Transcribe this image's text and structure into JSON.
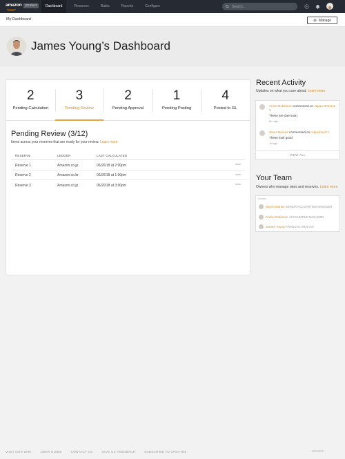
{
  "nav": {
    "logo_brand": "amazon",
    "logo_product": "product",
    "links": [
      "Dashboard",
      "Reserves",
      "Rates",
      "Reports",
      "Configure"
    ],
    "search_placeholder": "Search..."
  },
  "subheader": {
    "title": "My Dashboard",
    "manage_label": "Manage"
  },
  "hero": {
    "title": "James Young’s Dashboard"
  },
  "stats": [
    {
      "value": "2",
      "label": "Pending Calculation"
    },
    {
      "value": "3",
      "label": "Pending Review"
    },
    {
      "value": "2",
      "label": "Pending Approval"
    },
    {
      "value": "1",
      "label": "Pending Posting"
    },
    {
      "value": "4",
      "label": "Posted to GL"
    }
  ],
  "pending_review": {
    "title": "Pending Review (3/12)",
    "desc": "Items across your reserves that are ready for your review.",
    "learn_more": "Learn more",
    "columns": [
      "RESERVE",
      "LEDGER",
      "LAST CALCULATED"
    ],
    "rows": [
      {
        "reserve": "Reserve 1",
        "ledger": "Amazon.co.jp",
        "last": "06/26/18 at 2:00pm"
      },
      {
        "reserve": "Reserve 2",
        "ledger": "Amazon.co.br",
        "last": "06/26/18 at 1:00pm"
      },
      {
        "reserve": "Reserve 3",
        "ledger": "Amazon.co.jp",
        "last": "06/20/18 at 3:00pm"
      }
    ]
  },
  "recent_activity": {
    "title": "Recent Activity",
    "desc": "Updates on what you care about.",
    "learn_more": "Learn more",
    "items": [
      {
        "name": "Annie Robinson",
        "action": "commented on",
        "target": "Japan Reserve 1",
        "body": "These are due soon.",
        "time": "6m ago"
      },
      {
        "name": "Steve Barnes",
        "action": "commented on",
        "target": "Adjustment 1",
        "body": "These look good",
        "time": "1d ago"
      }
    ],
    "view_all": "VIEW ALL"
  },
  "your_team": {
    "title": "Your Team",
    "desc": "Owners who manage rates and reserves.",
    "learn_more": "Learn more",
    "header": "Owners",
    "members": [
      {
        "name": "Steve Barnes",
        "role": "SENIOR ACCOUNTING MANAGER"
      },
      {
        "name": "Annie Robinson",
        "role": "ACCOUNTING MANAGER"
      },
      {
        "name": "James Young",
        "role": "FINANCIAL ANALYST"
      }
    ]
  },
  "footer": {
    "links": [
      "VISIT OUR WIKI",
      "USER GUIDE",
      "CONTACT US",
      "GIVE US FEEDBACK",
      "SUBSCRIBE TO UPDATES"
    ],
    "brand": "amazon"
  },
  "colors": {
    "nav_bg": "#262b33",
    "accent": "#e8a33d",
    "link": "#d98b2f"
  }
}
